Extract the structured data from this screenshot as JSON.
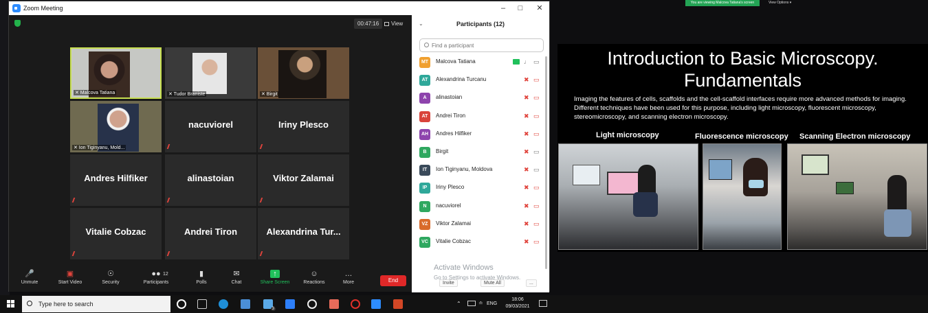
{
  "window": {
    "title": "Zoom Meeting"
  },
  "meeting": {
    "timer": "00:47:16",
    "view_label": "View",
    "tiles": [
      {
        "name": "Malcova Tatiana",
        "label": "Malcova Tatiana",
        "has_video": true,
        "active": true
      },
      {
        "name": "Tudor Braniste",
        "label": "Tudor Braniste",
        "has_video": true
      },
      {
        "name": "Birgit",
        "label": "Birgit",
        "has_video": true
      },
      {
        "name": "Ion Tiginyanu, Moldova",
        "label": "Ion Tiginyanu, Mold...",
        "has_video": true
      },
      {
        "name": "nacuviorel",
        "label": "",
        "has_video": false
      },
      {
        "name": "Iriny Plesco",
        "label": "",
        "has_video": false
      },
      {
        "name": "Andres Hilfiker",
        "label": "",
        "has_video": false
      },
      {
        "name": "alinastoian",
        "label": "",
        "has_video": false
      },
      {
        "name": "Viktor Zalamai",
        "label": "",
        "has_video": false
      },
      {
        "name": "Vitalie Cobzac",
        "label": "",
        "has_video": false
      },
      {
        "name": "Andrei Tiron",
        "label": "",
        "has_video": false
      },
      {
        "name": "Alexandrina  Tur...",
        "label": "",
        "has_video": false
      }
    ]
  },
  "toolbar": {
    "unmute": "Unmute",
    "start_video": "Start Video",
    "security": "Security",
    "participants": "Participants",
    "participants_count": "12",
    "polls": "Polls",
    "chat": "Chat",
    "share_screen": "Share Screen",
    "reactions": "Reactions",
    "more": "More",
    "end": "End"
  },
  "participants_panel": {
    "title": "Participants (12)",
    "search_placeholder": "Find a participant",
    "invite": "Invite",
    "mute_all": "Mute All",
    "more": "...",
    "list": [
      {
        "initials": "MT",
        "name": "Malcova Tatiana",
        "color": "#f0a030",
        "sharing": true
      },
      {
        "initials": "AT",
        "name": "Alexandrina Turcanu",
        "color": "#2fa89a"
      },
      {
        "initials": "A",
        "name": "alinastoian",
        "color": "#8e44ad"
      },
      {
        "initials": "AT",
        "name": "Andrei Tiron",
        "color": "#d9433b"
      },
      {
        "initials": "AH",
        "name": "Andres Hilfiker",
        "color": "#8e44ad"
      },
      {
        "initials": "B",
        "name": "Birgit",
        "color": "#2fa860"
      },
      {
        "initials": "IT",
        "name": "Ion Tiginyanu, Moldova",
        "color": "#3a4a5a"
      },
      {
        "initials": "IP",
        "name": "Iriny Plesco",
        "color": "#2fa89a"
      },
      {
        "initials": "N",
        "name": "nacuviorel",
        "color": "#2fa860"
      },
      {
        "initials": "VZ",
        "name": "Viktor Zalamai",
        "color": "#d96b2b"
      },
      {
        "initials": "VC",
        "name": "Vitalie Cobzac",
        "color": "#2fa860"
      }
    ]
  },
  "watermark": {
    "line1": "Activate Windows",
    "line2": "Go to Settings to activate Windows."
  },
  "share": {
    "banner": "You are viewing Malcova Tatiana's screen",
    "view_options": "View Options",
    "slide_title_1": "Introduction to Basic Microscopy.",
    "slide_title_2": "Fundamentals",
    "slide_body": "Imaging the features of cells, scaffolds and the cell-scaffold interfaces require more advanced methods for imaging.   Different techniques have been used for this purpose, including light microscopy, fluorescent microscopy, stereomicroscopy, and scanning electron microscopy.",
    "cap_light": "Light microscopy",
    "cap_fluor": "Fluorescence microscopy",
    "cap_sem": "Scanning Electron microscopy"
  },
  "taskbar": {
    "search_placeholder": "Type here to search",
    "lang": "ENG",
    "time": "18:06",
    "date": "09/03/2021",
    "mail_badge": "3"
  }
}
